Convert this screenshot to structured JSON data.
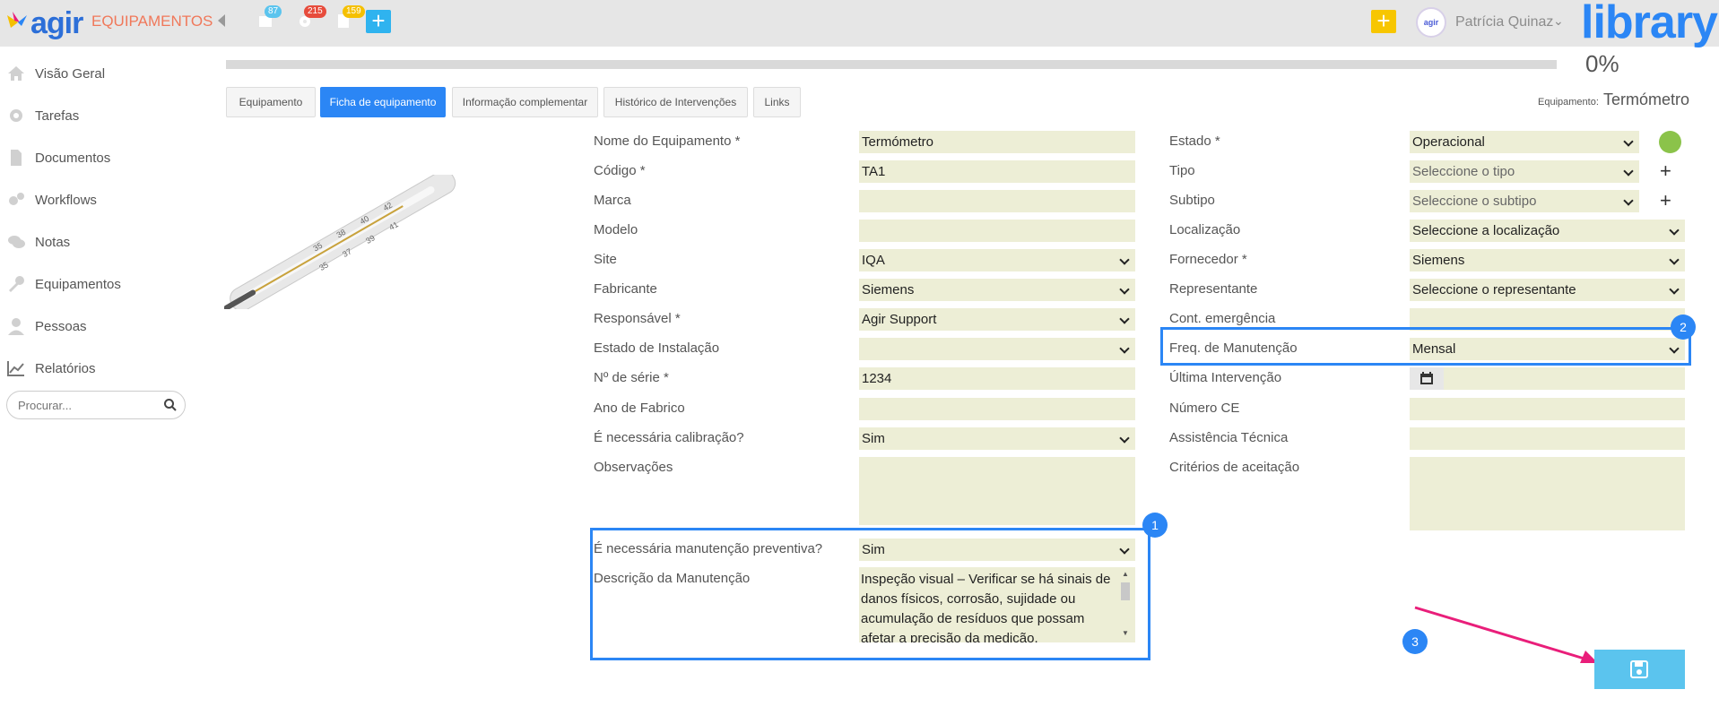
{
  "header": {
    "logo_text": "agir",
    "module": "EQUIPAMENTOS",
    "notifications": [
      {
        "icon": "calendar-icon",
        "count": "87",
        "color": "#5bc4ee"
      },
      {
        "icon": "gear-icon",
        "count": "215",
        "color": "#e74c3c"
      },
      {
        "icon": "document-icon",
        "count": "159",
        "color": "#f5c000"
      }
    ],
    "add_label": "+",
    "quick_add_label": "+",
    "avatar_text": "agir",
    "user_name": "Patrícia Quinaz",
    "brand": "library"
  },
  "sidebar": {
    "items": [
      {
        "label": "Visão Geral",
        "icon": "home-icon"
      },
      {
        "label": "Tarefas",
        "icon": "gear-icon"
      },
      {
        "label": "Documentos",
        "icon": "document-icon"
      },
      {
        "label": "Workflows",
        "icon": "cogs-icon"
      },
      {
        "label": "Notas",
        "icon": "chat-icon"
      },
      {
        "label": "Equipamentos",
        "icon": "wrench-icon"
      },
      {
        "label": "Pessoas",
        "icon": "person-icon"
      },
      {
        "label": "Relatórios",
        "icon": "chart-icon"
      }
    ],
    "search_placeholder": "Procurar..."
  },
  "progress": {
    "value": 0,
    "label": "0%"
  },
  "tabs": [
    "Equipamento",
    "Ficha de equipamento",
    "Informação complementar",
    "Histórico de Intervenções",
    "Links"
  ],
  "active_tab": "Ficha de equipamento",
  "equipment": {
    "label": "Equipamento:",
    "value": "Termómetro"
  },
  "form_left": [
    {
      "label": "Nome do Equipamento *",
      "value": "Termómetro"
    },
    {
      "label": "Código *",
      "value": "TA1"
    },
    {
      "label": "Marca",
      "value": ""
    },
    {
      "label": "Modelo",
      "value": ""
    },
    {
      "label": "Site",
      "value": "IQA"
    },
    {
      "label": "Fabricante",
      "value": "Siemens"
    },
    {
      "label": "Responsável *",
      "value": "Agir Support"
    },
    {
      "label": "Estado de Instalação",
      "value": ""
    },
    {
      "label": "Nº de série *",
      "value": "1234"
    },
    {
      "label": "Ano de Fabrico",
      "value": ""
    },
    {
      "label": "É necessária calibração?",
      "value": "Sim"
    },
    {
      "label": "Observações",
      "value": ""
    },
    {
      "label": "É necessária manutenção preventiva?",
      "value": "Sim"
    },
    {
      "label": "Descrição da Manutenção",
      "value": "Inspeção visual – Verificar se há sinais de danos físicos, corrosão, sujidade ou acumulação de resíduos que possam afetar a precisão da medição."
    }
  ],
  "form_right": [
    {
      "label": "Estado *",
      "value": "Operacional"
    },
    {
      "label": "Tipo",
      "value": "Seleccione o tipo"
    },
    {
      "label": "Subtipo",
      "value": "Seleccione o subtipo"
    },
    {
      "label": "Localização",
      "value": "Seleccione a localização"
    },
    {
      "label": "Fornecedor *",
      "value": "Siemens"
    },
    {
      "label": "Representante",
      "value": "Seleccione o representante"
    },
    {
      "label": "Cont. emergência",
      "value": ""
    },
    {
      "label": "Freq. de Manutenção",
      "value": "Mensal"
    },
    {
      "label": "Última Intervenção",
      "value": ""
    },
    {
      "label": "Número CE",
      "value": ""
    },
    {
      "label": "Assistência Técnica",
      "value": ""
    },
    {
      "label": "Critérios de aceitação",
      "value": ""
    }
  ],
  "status_color": "#8bc34a",
  "annotations": [
    "1",
    "2",
    "3"
  ],
  "colors": {
    "accent": "#2b86f5",
    "save": "#5bc4ee",
    "arrow": "#e91e7a",
    "field_bg": "#edeed6"
  }
}
